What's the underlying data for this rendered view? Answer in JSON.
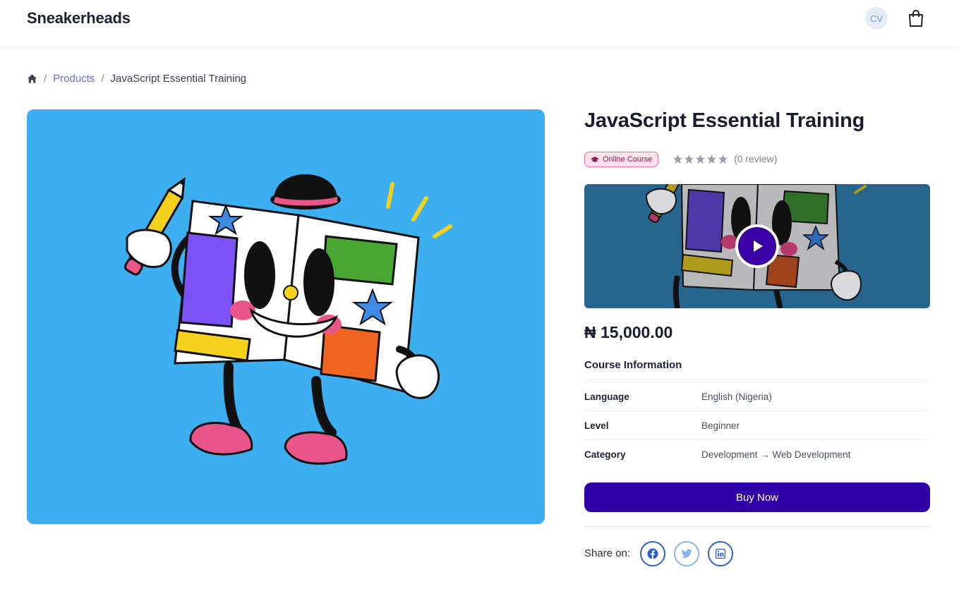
{
  "header": {
    "brand": "Sneakerheads",
    "avatar_initials": "CV",
    "cart_icon": "shopping-bag-icon"
  },
  "breadcrumb": {
    "home_icon": "home-icon",
    "separator": "/",
    "items": [
      "Products",
      "JavaScript Essential Training"
    ]
  },
  "product": {
    "title": "JavaScript Essential Training",
    "badge": "Online Course",
    "badge_icon": "graduation-cap-icon",
    "rating": 0,
    "rating_max": 5,
    "reviews": "(0 review)",
    "price": "₦ 15,000.00",
    "video_play_icon": "play-icon"
  },
  "course_info": {
    "title": "Course Information",
    "rows": [
      {
        "label": "Language",
        "value": "English (Nigeria)"
      },
      {
        "label": "Level",
        "value": "Beginner"
      },
      {
        "label": "Category",
        "value": "Development → Web Development"
      }
    ]
  },
  "actions": {
    "buy_label": "Buy Now",
    "share_label": "Share on:",
    "share_icons": [
      "facebook-icon",
      "twitter-icon",
      "linkedin-icon"
    ]
  },
  "colors": {
    "primary": "#3200a8",
    "hero_bg": "#3daef0",
    "video_bg": "#25658e",
    "badge_border": "#e86aa6",
    "badge_bg": "#fde2ee",
    "link": "#6b6dc9"
  }
}
